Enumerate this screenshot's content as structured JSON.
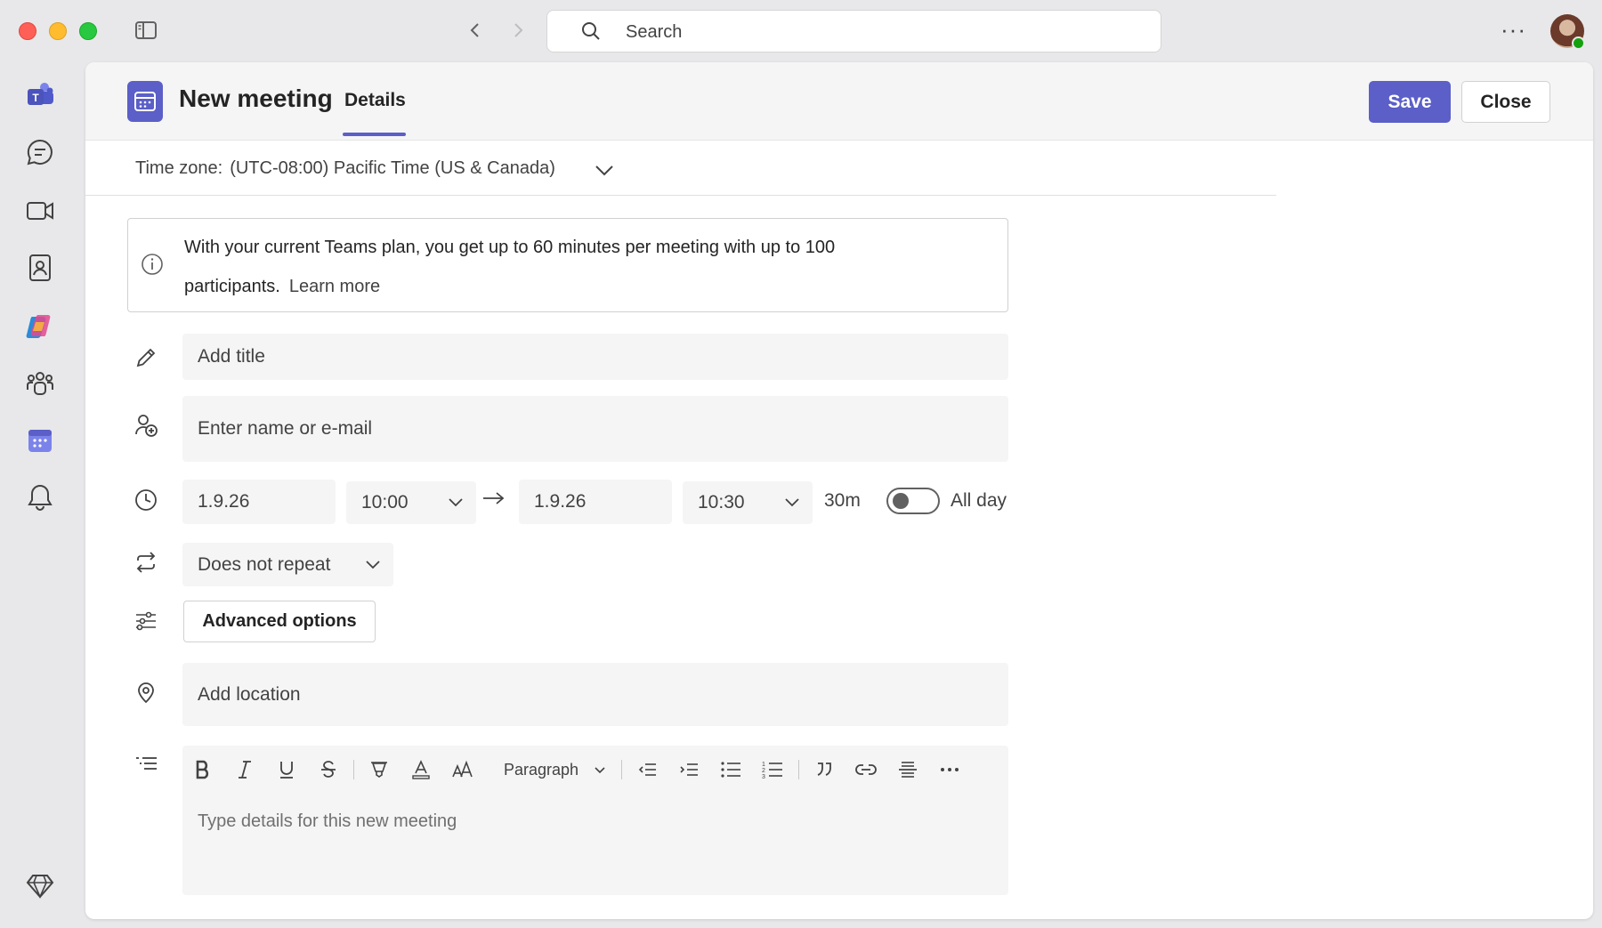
{
  "window": {
    "search": {
      "placeholder": "Search"
    },
    "more_label": "···"
  },
  "rail": {
    "items": [
      {
        "name": "teams-logo-icon"
      },
      {
        "name": "chat-icon"
      },
      {
        "name": "meet-icon"
      },
      {
        "name": "contacts-icon"
      },
      {
        "name": "copilot-icon"
      },
      {
        "name": "communities-icon"
      },
      {
        "name": "calendar-icon"
      },
      {
        "name": "activity-icon"
      },
      {
        "name": "premium-icon"
      }
    ]
  },
  "header": {
    "title": "New meeting",
    "tab": "Details",
    "save_label": "Save",
    "close_label": "Close"
  },
  "timezone": {
    "label": "Time zone:",
    "value": "(UTC-08:00) Pacific Time (US & Canada)"
  },
  "banner": {
    "text": "With your current Teams plan, you get up to 60 minutes per meeting with up to 100 participants.",
    "link": "Learn more"
  },
  "form": {
    "title_placeholder": "Add title",
    "attendees_placeholder": "Enter name or e-mail",
    "start_date": "1.9.26",
    "start_time": "10:00",
    "end_date": "1.9.26",
    "end_time": "10:30",
    "duration": "30m",
    "all_day_label": "All day",
    "all_day_on": false,
    "repeat": "Does not repeat",
    "advanced_label": "Advanced options",
    "location_placeholder": "Add location",
    "details_placeholder": "Type details for this new meeting",
    "paragraph_style": "Paragraph"
  },
  "colors": {
    "accent": "#5b5fc7",
    "panel_bg": "#ffffff",
    "field_bg": "#f5f5f5"
  }
}
